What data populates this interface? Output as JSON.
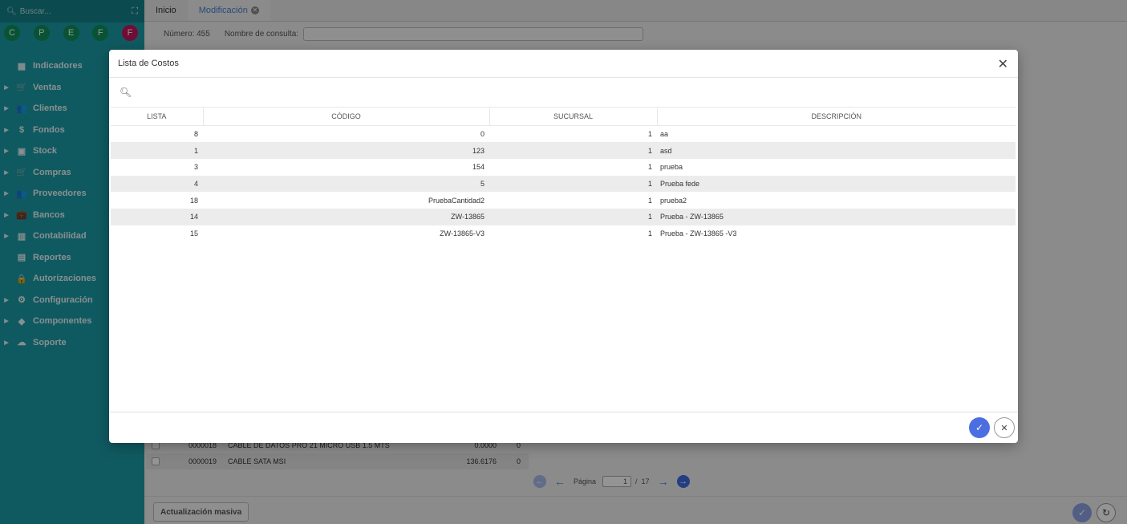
{
  "sidebar": {
    "search_placeholder": "Buscar...",
    "quick": [
      "C",
      "P",
      "E",
      "F",
      "F"
    ],
    "items": [
      {
        "label": "Indicadores",
        "icon": "dashboard-icon",
        "glyph": "▦",
        "arrow": ""
      },
      {
        "label": "Ventas",
        "icon": "cart-icon",
        "glyph": "🛒",
        "arrow": "▶"
      },
      {
        "label": "Clientes",
        "icon": "people-icon",
        "glyph": "👥",
        "arrow": "▶"
      },
      {
        "label": "Fondos",
        "icon": "dollar-icon",
        "glyph": "$",
        "arrow": "▶"
      },
      {
        "label": "Stock",
        "icon": "box-icon",
        "glyph": "▣",
        "arrow": "▶"
      },
      {
        "label": "Compras",
        "icon": "cart-plus-icon",
        "glyph": "🛒",
        "arrow": "▶"
      },
      {
        "label": "Proveedores",
        "icon": "people-icon",
        "glyph": "👥",
        "arrow": "▶"
      },
      {
        "label": "Bancos",
        "icon": "briefcase-icon",
        "glyph": "💼",
        "arrow": "▶"
      },
      {
        "label": "Contabilidad",
        "icon": "book-icon",
        "glyph": "▥",
        "arrow": "▶"
      },
      {
        "label": "Reportes",
        "icon": "report-icon",
        "glyph": "▤",
        "arrow": ""
      },
      {
        "label": "Autorizaciones",
        "icon": "lock-icon",
        "glyph": "🔒",
        "arrow": ""
      },
      {
        "label": "Configuración",
        "icon": "gears-icon",
        "glyph": "⚙",
        "arrow": "▶"
      },
      {
        "label": "Componentes",
        "icon": "tag-icon",
        "glyph": "◆",
        "arrow": "▶"
      },
      {
        "label": "Soporte",
        "icon": "cloud-icon",
        "glyph": "☁",
        "arrow": "▶"
      }
    ]
  },
  "tabs": [
    {
      "label": "Inicio"
    },
    {
      "label": "Modificación"
    }
  ],
  "subbar": {
    "numero": "Número: 455",
    "nombre_label": "Nombre de consulta:"
  },
  "background_rows": [
    {
      "code": "0000018",
      "desc": "CABLE DE DATOS PRO 21 MICRO USB 1.5 MTS",
      "value": "0.0000",
      "zero": "0"
    },
    {
      "code": "0000019",
      "desc": "CABLE SATA MSI",
      "value": "136.6176",
      "zero": "0"
    }
  ],
  "pager": {
    "label": "Página",
    "page": "1",
    "sep": "/",
    "total": "17"
  },
  "bottom": {
    "masiva_label": "Actualización masiva"
  },
  "modal": {
    "title": "Lista de Costos",
    "columns": [
      "LISTA",
      "CÓDIGO",
      "SUCURSAL",
      "DESCRIPCIÓN"
    ],
    "rows": [
      [
        "8",
        "0",
        "1",
        "aa"
      ],
      [
        "1",
        "123",
        "1",
        "asd"
      ],
      [
        "3",
        "154",
        "1",
        "prueba"
      ],
      [
        "4",
        "5",
        "1",
        "Prueba fede"
      ],
      [
        "18",
        "PruebaCantidad2",
        "1",
        "prueba2"
      ],
      [
        "14",
        "ZW-13865",
        "1",
        "Prueba - ZW-13865"
      ],
      [
        "15",
        "ZW-13865-V3",
        "1",
        "Prueba - ZW-13865 -V3"
      ]
    ]
  }
}
